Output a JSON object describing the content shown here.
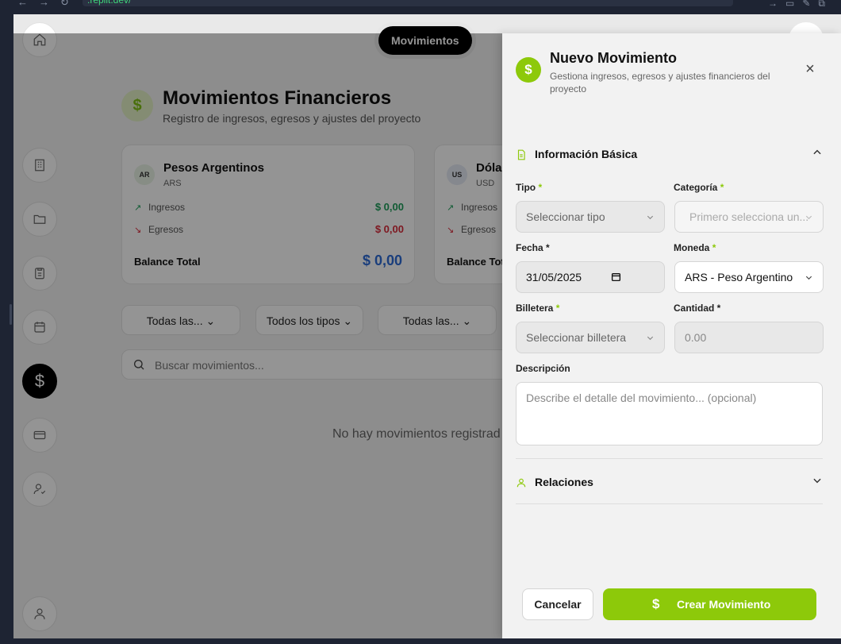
{
  "browser": {
    "url": ".replit.dev/"
  },
  "tab": {
    "label": "Movimientos"
  },
  "header": {
    "title": "Movimientos Financieros",
    "subtitle": "Registro de ingresos, egresos y ajustes del proyecto",
    "icon": "dollar-icon"
  },
  "cards": [
    {
      "badge": "AR",
      "name": "Pesos Argentinos",
      "code": "ARS",
      "income_label": "Ingresos",
      "income": "$ 0,00",
      "expense_label": "Egresos",
      "expense": "$ 0,00",
      "total_label": "Balance Total",
      "total": "$ 0,00"
    },
    {
      "badge": "US",
      "name": "Dóla",
      "code": "USD",
      "income_label": "Ingresos",
      "expense_label": "Egresos",
      "total_label": "Balance Tot"
    }
  ],
  "filters": [
    "Todas las...",
    "Todos los tipos",
    "Todas las..."
  ],
  "search": {
    "placeholder": "Buscar movimientos..."
  },
  "empty_message": "No hay movimientos registrad",
  "panel": {
    "title": "Nuevo Movimiento",
    "subtitle": "Gestiona ingresos, egresos y ajustes financieros del proyecto",
    "section_basic": "Información Básica",
    "tipo": {
      "label": "Tipo",
      "req": "*",
      "placeholder": "Seleccionar tipo"
    },
    "categoria": {
      "label": "Categoría",
      "req": "*",
      "placeholder": "Primero selecciona un..."
    },
    "fecha": {
      "label": "Fecha *",
      "value": "31/05/2025"
    },
    "moneda": {
      "label": "Moneda",
      "req": "*",
      "value": "ARS - Peso Argentino"
    },
    "billetera": {
      "label": "Billetera",
      "req": "*",
      "placeholder": "Seleccionar billetera"
    },
    "cantidad": {
      "label": "Cantidad *",
      "placeholder": "0.00"
    },
    "descripcion": {
      "label": "Descripción",
      "placeholder": "Describe el detalle del movimiento... (opcional)"
    },
    "section_relations": "Relaciones",
    "cancel": "Cancelar",
    "create": "Crear Movimiento",
    "accent": "#8dc90a"
  }
}
